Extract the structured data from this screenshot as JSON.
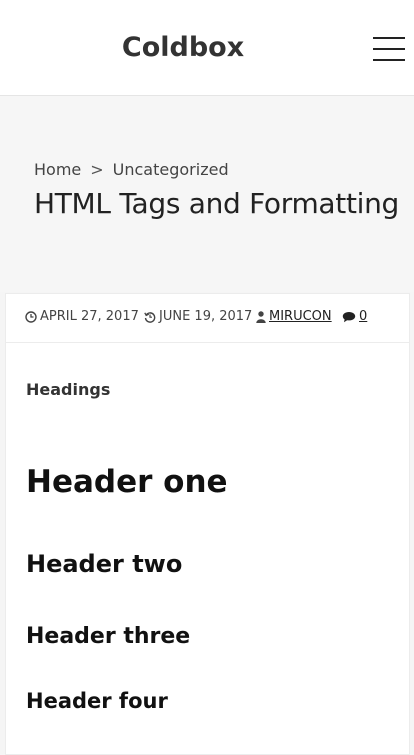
{
  "header": {
    "site_title": "Coldbox",
    "menu_icon": "hamburger-menu-icon"
  },
  "hero": {
    "breadcrumb": {
      "home": "Home",
      "separator": ">",
      "category": "Uncategorized"
    },
    "title": "HTML Tags and Formatting"
  },
  "post_meta": {
    "published": "APRIL 27, 2017",
    "published_icon": "clock-icon",
    "updated": "JUNE 19, 2017",
    "updated_icon": "history-icon",
    "author": "MIRUCON",
    "author_icon": "user-icon",
    "comments": "0",
    "comments_icon": "comment-icon"
  },
  "content": {
    "section_label": "Headings",
    "h1": "Header one",
    "h2": "Header two",
    "h3": "Header three",
    "h4": "Header four"
  }
}
